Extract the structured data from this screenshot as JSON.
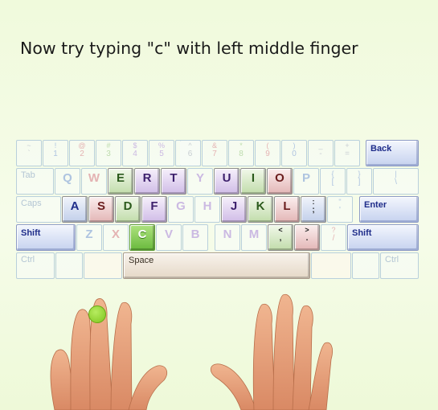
{
  "instruction": "Now try typing \"c\" with left middle finger",
  "colors": {
    "left_pinky": "#e3b6b6",
    "left_ring": "#c1dcaa",
    "left_middle": "#d0bce7",
    "index": "#c2cfea",
    "highlight": "#7ec51e",
    "skin": "#e8a07a"
  },
  "target_key": "C",
  "target_finger": "left middle finger",
  "keyboard": {
    "row1": [
      {
        "top": "~",
        "bot": "`"
      },
      {
        "top": "!",
        "bot": "1"
      },
      {
        "top": "@",
        "bot": "2"
      },
      {
        "top": "#",
        "bot": "3"
      },
      {
        "top": "$",
        "bot": "4"
      },
      {
        "top": "%",
        "bot": "5"
      },
      {
        "top": "^",
        "bot": "6"
      },
      {
        "top": "&",
        "bot": "7"
      },
      {
        "top": "*",
        "bot": "8"
      },
      {
        "top": "(",
        "bot": "9"
      },
      {
        "top": ")",
        "bot": "0"
      },
      {
        "top": "_",
        "bot": "-"
      },
      {
        "top": "+",
        "bot": "="
      }
    ],
    "back_label": "Back",
    "tab_label": "Tab",
    "row2": [
      "Q",
      "W",
      "E",
      "R",
      "T",
      "Y",
      "U",
      "I",
      "O",
      "P"
    ],
    "row2_brackets": [
      {
        "top": "{",
        "bot": "["
      },
      {
        "top": "}",
        "bot": "]"
      },
      {
        "top": "|",
        "bot": "\\"
      }
    ],
    "caps_label": "Caps",
    "row3": [
      "A",
      "S",
      "D",
      "F",
      "G",
      "H",
      "J",
      "K",
      "L"
    ],
    "row3_punct": [
      {
        "top": ":",
        "bot": ";"
      },
      {
        "top": "\"",
        "bot": "'"
      }
    ],
    "enter_label": "Enter",
    "shift_label": "Shift",
    "row4": [
      "Z",
      "X",
      "C",
      "V",
      "B",
      "N",
      "M"
    ],
    "row4_punct": [
      {
        "top": "<",
        "bot": ","
      },
      {
        "top": ">",
        "bot": "."
      },
      {
        "top": "?",
        "bot": "/"
      }
    ],
    "ctrl_label": "Ctrl",
    "space_label": "Space"
  }
}
